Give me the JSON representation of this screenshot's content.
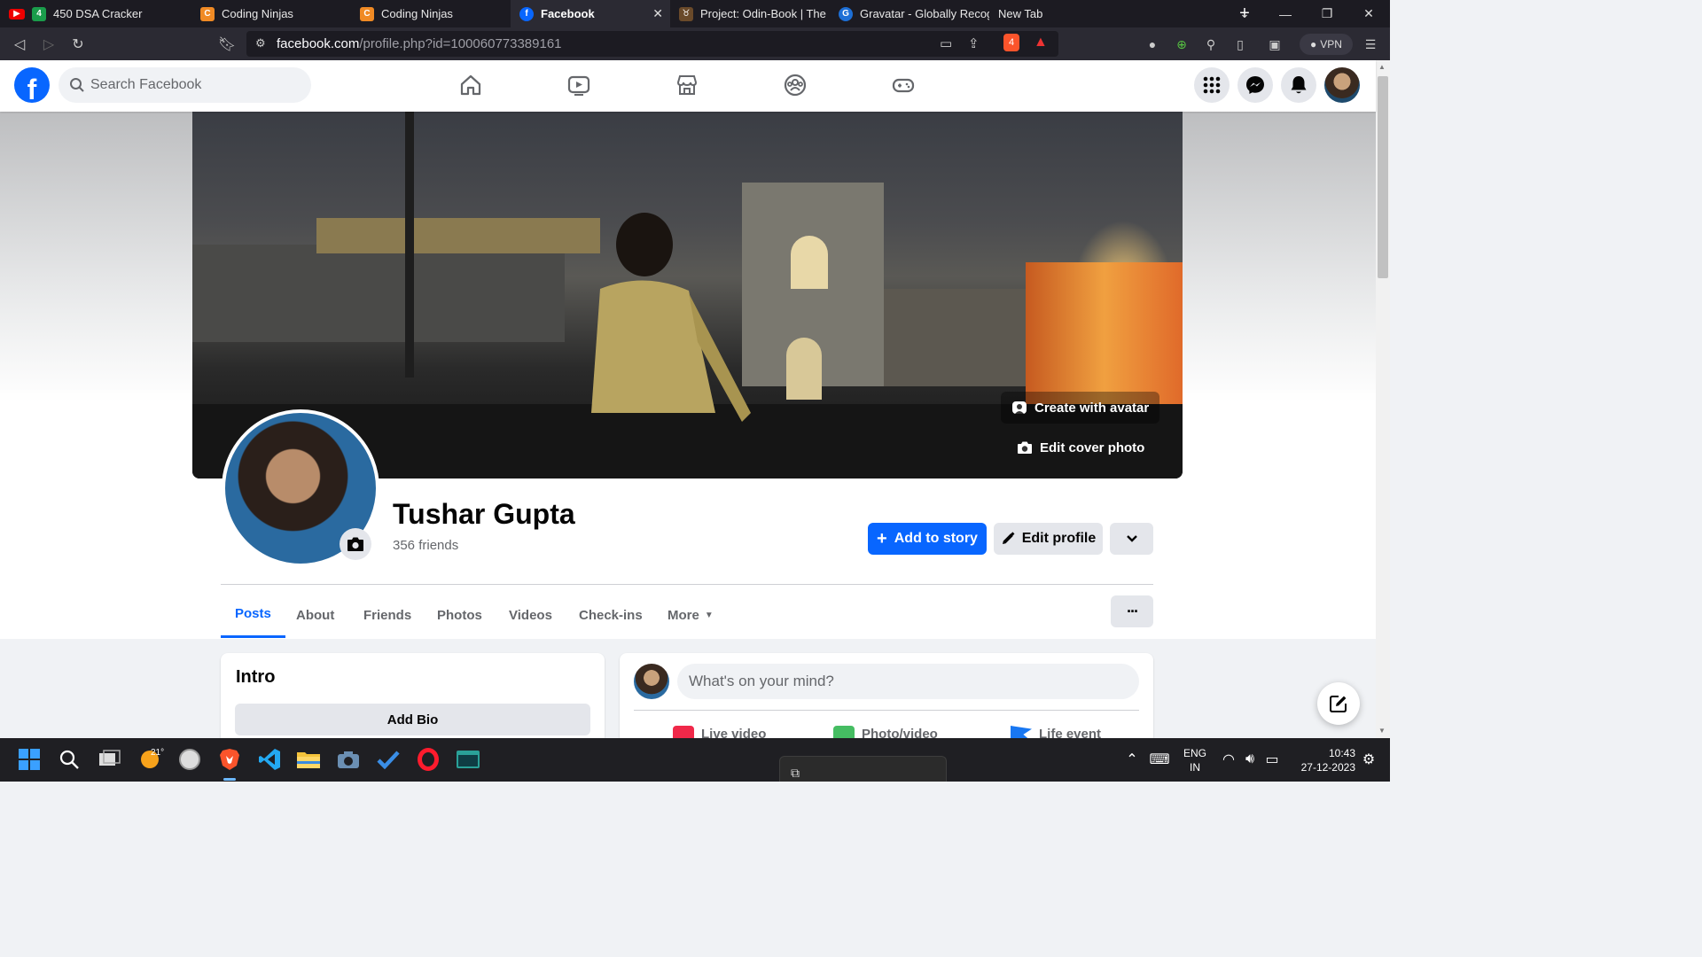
{
  "browser": {
    "tabs": [
      {
        "label": "450 DSA Cracker",
        "favicon_text": "4",
        "favicon_color": "#1a9c4b"
      },
      {
        "label": "Coding Ninjas",
        "favicon_text": "C",
        "favicon_color": "#f08a24"
      },
      {
        "label": "Coding Ninjas",
        "favicon_text": "C",
        "favicon_color": "#f08a24"
      },
      {
        "label": "Facebook",
        "favicon_text": "f",
        "favicon_color": "#0866ff"
      },
      {
        "label": "Project: Odin-Book | The C",
        "favicon_text": "♉",
        "favicon_color": "#6a4a2a"
      },
      {
        "label": "Gravatar - Globally Recogn",
        "favicon_text": "G",
        "favicon_color": "#1d6fd6"
      },
      {
        "label": "New Tab",
        "favicon_text": "",
        "favicon_color": "#1c1b22"
      }
    ],
    "url_host": "facebook.com",
    "url_path": "/profile.php?id=100060773389161",
    "vpn_label": "VPN",
    "shield_badge": "4"
  },
  "header": {
    "search_placeholder": "Search Facebook",
    "logo_letter": "f"
  },
  "profile": {
    "name": "Tushar Gupta",
    "friends": "356 friends",
    "cover_buttons": {
      "create_avatar": "Create with avatar",
      "edit_cover": "Edit cover photo"
    },
    "actions": {
      "add_to_story": "Add to story",
      "edit_profile": "Edit profile"
    },
    "tabs": [
      "Posts",
      "About",
      "Friends",
      "Photos",
      "Videos",
      "Check-ins",
      "More"
    ],
    "more_options": "···"
  },
  "intro": {
    "title": "Intro",
    "add_bio": "Add Bio"
  },
  "composer": {
    "placeholder": "What's on your mind?",
    "actions": [
      "Live video",
      "Photo/video",
      "Life event"
    ]
  },
  "taskbar": {
    "weather": "21°",
    "language": "ENG",
    "region": "IN",
    "time": "10:43",
    "date": "27-12-2023"
  },
  "colors": {
    "fb_blue": "#0866ff",
    "page_bg": "#f0f2f5",
    "secondary_button": "#e4e6eb"
  }
}
